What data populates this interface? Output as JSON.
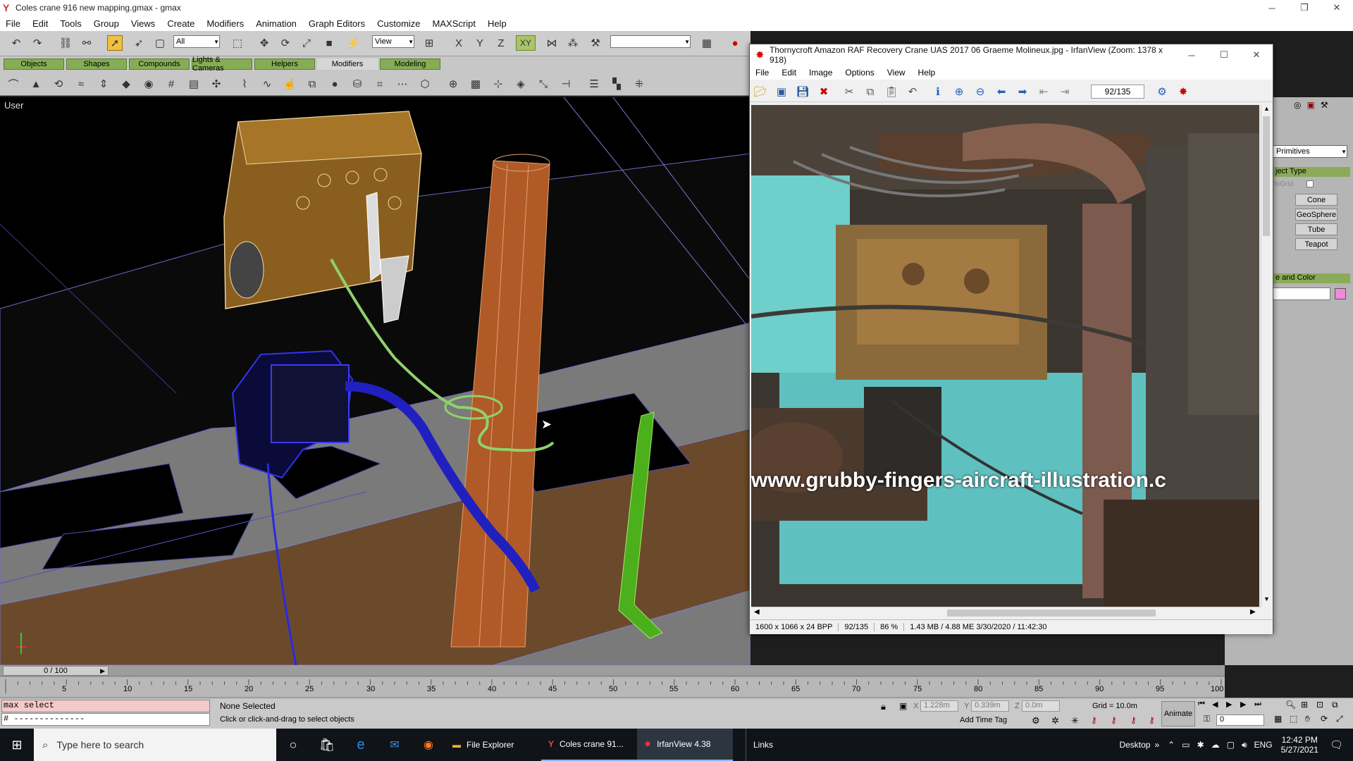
{
  "gmax": {
    "title": "Coles crane 916 new mapping.gmax - gmax",
    "menu": [
      "File",
      "Edit",
      "Tools",
      "Group",
      "Views",
      "Create",
      "Modifiers",
      "Animation",
      "Graph Editors",
      "Customize",
      "MAXScript",
      "Help"
    ],
    "selection_filter": "All",
    "ref_coord": "View",
    "tabs": [
      "Objects",
      "Shapes",
      "Compounds",
      "Lights & Cameras",
      "Helpers",
      "Modifiers",
      "Modeling"
    ],
    "active_tab": "Modifiers",
    "viewport_label": "User",
    "right_panel": {
      "dropdown": "Primitives",
      "rollout_object_type": "ject Type",
      "autogrid": "toGrid",
      "buttons": [
        "Cone",
        "GeoSphere",
        "Tube",
        "Teapot"
      ],
      "rollout_name_color": "e and Color"
    },
    "timeline": {
      "frame_label": "0 / 100",
      "ticks": [
        "5",
        "10",
        "15",
        "20",
        "25",
        "30",
        "35",
        "40",
        "45",
        "50",
        "55",
        "60",
        "65",
        "70",
        "75",
        "80",
        "85",
        "90",
        "95",
        "100"
      ]
    },
    "status": {
      "maxscript_line1": "max select",
      "maxscript_line2": "# --------------",
      "selection": "None Selected",
      "prompt": "Click or click-and-drag to select objects",
      "x_label": "X",
      "x_value": "1.228m",
      "y_label": "Y",
      "y_value": "0.339m",
      "z_label": "Z",
      "z_value": "0.0m",
      "grid": "Grid = 10.0m",
      "add_time_tag": "Add Time Tag",
      "animate": "Animate",
      "frame_field": "0"
    }
  },
  "irfan": {
    "title": "Thornycroft Amazon RAF Recovery Crane UAS 2017 06 Graeme Molineux.jpg - IrfanView (Zoom: 1378 x 918)",
    "menu": [
      "File",
      "Edit",
      "Image",
      "Options",
      "View",
      "Help"
    ],
    "page_field": "92/135",
    "watermark": "www.grubby-fingers-aircraft-illustration.c",
    "status": [
      "1600 x 1066 x 24 BPP",
      "92/135",
      "86 %",
      "1.43 MB / 4.88 ME 3/30/2020 / 11:42:30"
    ]
  },
  "taskbar": {
    "search_placeholder": "Type here to search",
    "apps": [
      "File Explorer",
      "Coles crane 91...",
      "IrfanView 4.38"
    ],
    "links": "Links",
    "desktop": "Desktop",
    "lang": "ENG",
    "time": "12:42 PM",
    "date": "5/27/2021"
  },
  "colors": {
    "gmax_tab_green": "#86ad54",
    "wire_blue": "#2a2ae0",
    "wire_green": "#8fd16b",
    "post_orange": "#b05a28",
    "ground_brown": "#6b4a2c"
  }
}
